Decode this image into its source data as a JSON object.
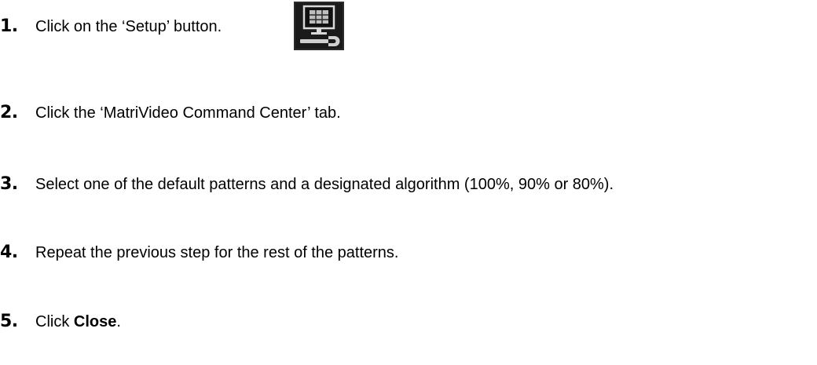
{
  "steps": [
    {
      "number": "1.",
      "text": "Click on the ‘Setup’ button."
    },
    {
      "number": "2.",
      "text": "Click the ‘MatriVideo Command Center’ tab."
    },
    {
      "number": "3.",
      "text": "Select one of the default patterns and a designated algorithm (100%, 90% or 80%)."
    },
    {
      "number": "4.",
      "text": "Repeat the previous step for the rest of the patterns."
    },
    {
      "number": "5.",
      "text_prefix": "Click ",
      "text_bold": "Close",
      "text_suffix": "."
    }
  ],
  "setup_icon": {
    "name": "setup-monitor-wrench-icon"
  }
}
